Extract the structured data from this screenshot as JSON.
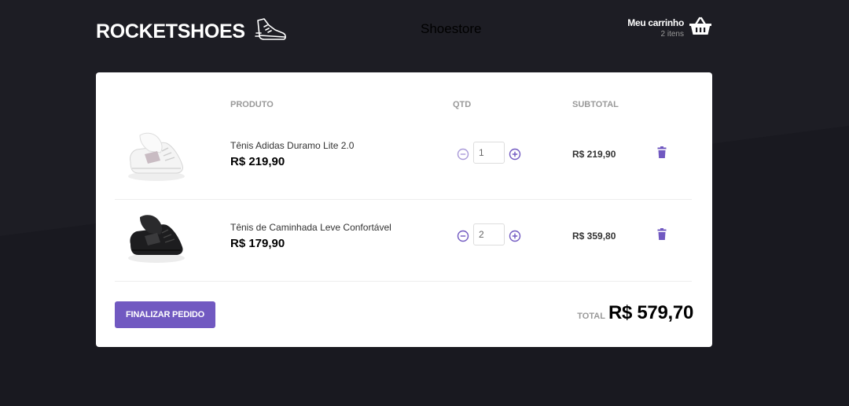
{
  "header": {
    "logo_text": "ROCKETSHOES",
    "center_title": "Shoestore",
    "cart_title": "Meu carrinho",
    "cart_count": "2 itens"
  },
  "table": {
    "col_product": "PRODUTO",
    "col_qty": "QTD",
    "col_subtotal": "SUBTOTAL",
    "rows": [
      {
        "name": "Tênis Adidas Duramo Lite 2.0",
        "price": "R$ 219,90",
        "qty": "1",
        "subtotal": "R$ 219,90",
        "shoe_color": "white"
      },
      {
        "name": "Tênis de Caminhada Leve Confortável",
        "price": "R$ 179,90",
        "qty": "2",
        "subtotal": "R$ 359,80",
        "shoe_color": "black"
      }
    ]
  },
  "footer": {
    "finalize_label": "FINALIZAR PEDIDO",
    "total_label": "TOTAL",
    "total_value": "R$ 579,70"
  },
  "colors": {
    "accent": "#7159c1",
    "background": "#191920"
  },
  "icons": {
    "logo": "running-shoe-icon",
    "cart": "shopping-basket-icon",
    "decrement": "minus-circle-icon",
    "increment": "plus-circle-icon",
    "remove": "trash-icon"
  }
}
